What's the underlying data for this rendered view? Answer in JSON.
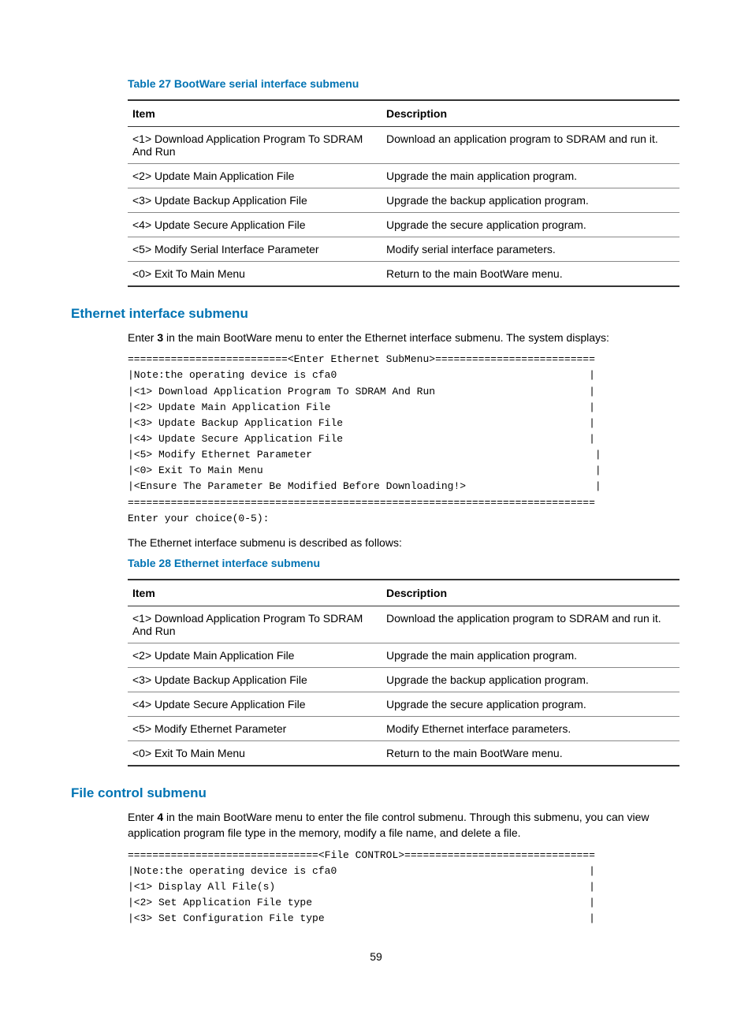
{
  "table27": {
    "caption": "Table 27 BootWare serial interface submenu",
    "headers": {
      "item": "Item",
      "desc": "Description"
    },
    "rows": [
      {
        "item": "<1> Download Application Program To SDRAM And Run",
        "desc": "Download an application program to SDRAM and run it."
      },
      {
        "item": "<2> Update Main Application File",
        "desc": "Upgrade the main application program."
      },
      {
        "item": "<3> Update Backup Application File",
        "desc": "Upgrade the backup application program."
      },
      {
        "item": "<4> Update Secure Application File",
        "desc": "Upgrade the secure application program."
      },
      {
        "item": "<5> Modify Serial Interface Parameter",
        "desc": "Modify serial interface parameters."
      },
      {
        "item": "<0> Exit To Main Menu",
        "desc": "Return to the main BootWare menu."
      }
    ]
  },
  "ethernet": {
    "heading": "Ethernet interface submenu",
    "intro_pre": "Enter ",
    "intro_bold": "3",
    "intro_post": " in the main BootWare menu to enter the Ethernet interface submenu. The system displays:",
    "terminal": "==========================<Enter Ethernet SubMenu>==========================\n|Note:the operating device is cfa0                                         |\n|<1> Download Application Program To SDRAM And Run                         |\n|<2> Update Main Application File                                          |\n|<3> Update Backup Application File                                        |\n|<4> Update Secure Application File                                        |\n|<5> Modify Ethernet Parameter                                              |\n|<0> Exit To Main Menu                                                      |\n|<Ensure The Parameter Be Modified Before Downloading!>                     |\n============================================================================\nEnter your choice(0-5):",
    "after": "The Ethernet interface submenu is described as follows:"
  },
  "table28": {
    "caption": "Table 28 Ethernet interface submenu",
    "headers": {
      "item": "Item",
      "desc": "Description"
    },
    "rows": [
      {
        "item": "<1> Download Application Program To SDRAM And Run",
        "desc": "Download the application program to SDRAM and run it."
      },
      {
        "item": "<2> Update Main Application File",
        "desc": "Upgrade the main application program."
      },
      {
        "item": "<3> Update Backup Application File",
        "desc": "Upgrade the backup application program."
      },
      {
        "item": "<4> Update Secure Application File",
        "desc": "Upgrade the secure application program."
      },
      {
        "item": "<5> Modify Ethernet Parameter",
        "desc": "Modify Ethernet interface parameters."
      },
      {
        "item": "<0> Exit To Main Menu",
        "desc": "Return to the main BootWare menu."
      }
    ]
  },
  "filectrl": {
    "heading": "File control submenu",
    "intro_pre": "Enter ",
    "intro_bold": "4",
    "intro_post": " in the main BootWare menu to enter the file control submenu. Through this submenu, you can view application program file type in the memory, modify a file name, and delete a file.",
    "terminal": "===============================<File CONTROL>===============================\n|Note:the operating device is cfa0                                         |\n|<1> Display All File(s)                                                   |\n|<2> Set Application File type                                             |\n|<3> Set Configuration File type                                           |"
  },
  "page_number": "59"
}
